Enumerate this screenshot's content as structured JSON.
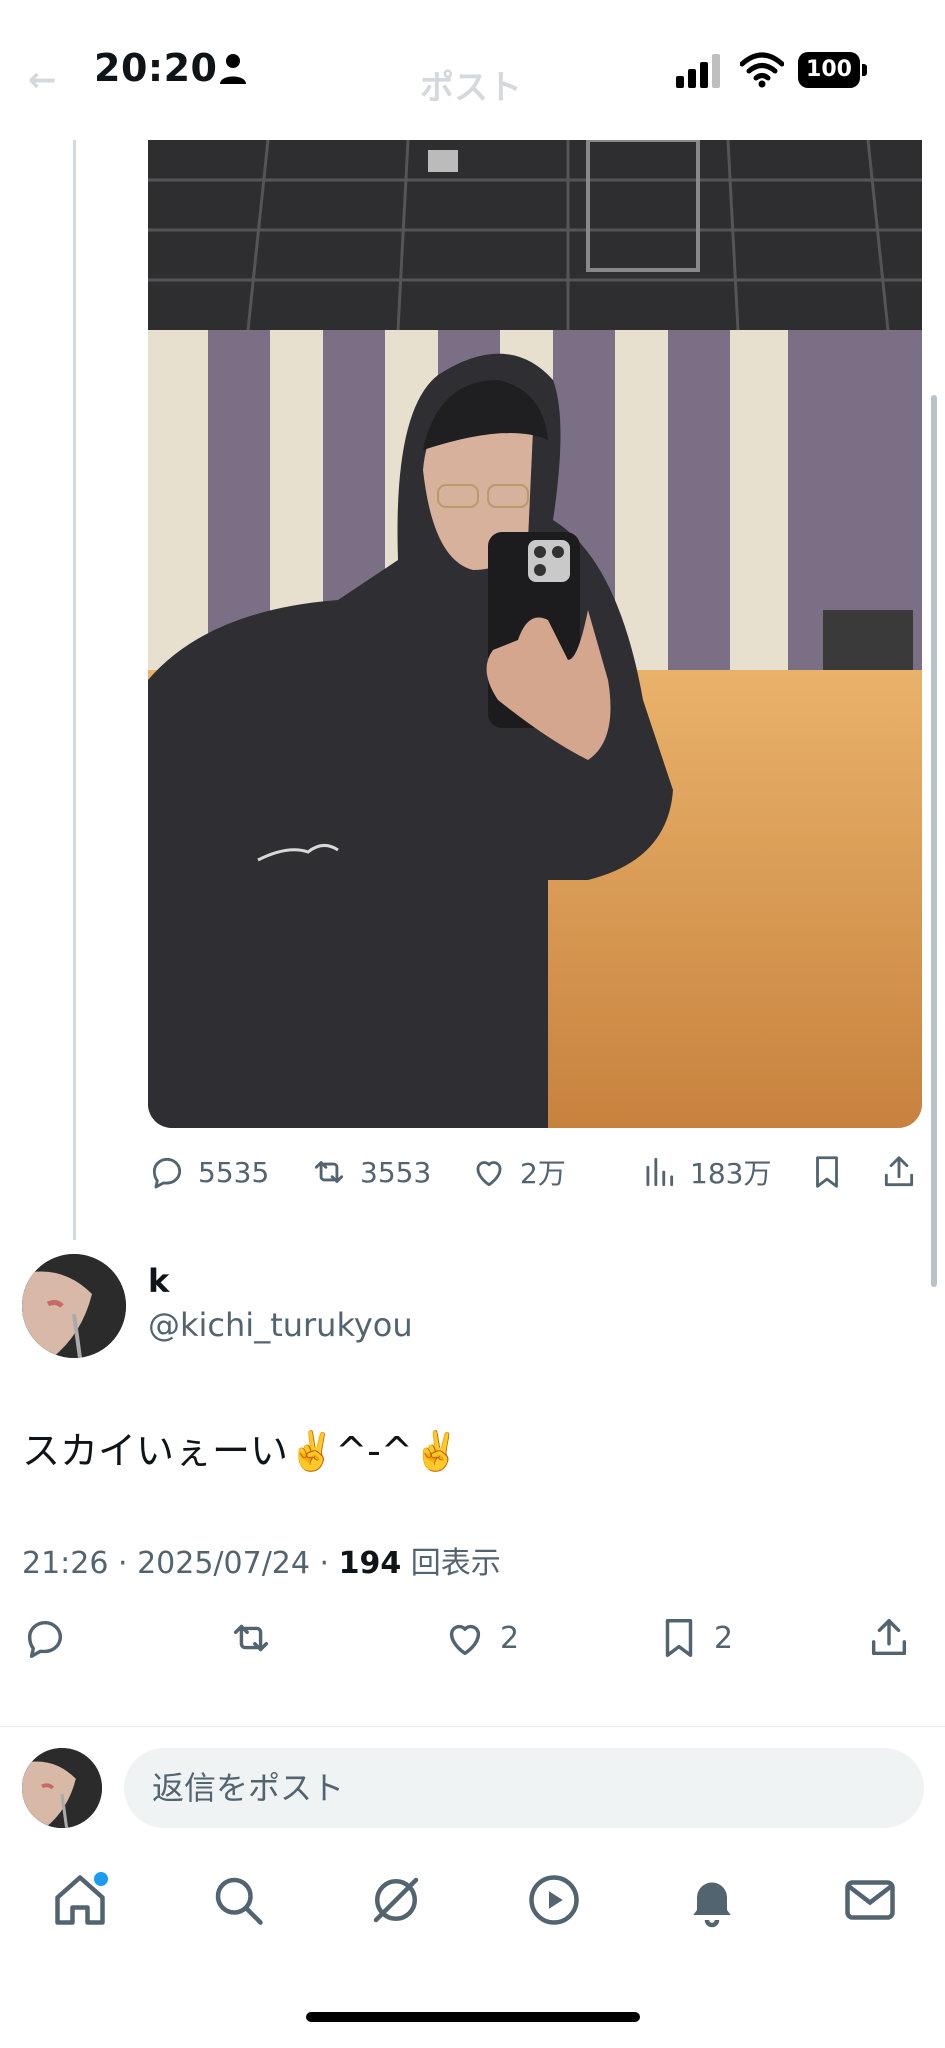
{
  "status_bar": {
    "time": "20:20",
    "battery": "100"
  },
  "header": {
    "title_ghost": "ポスト"
  },
  "previous_post": {
    "stats": {
      "replies": "5535",
      "reposts": "3553",
      "likes": "2万",
      "views": "183万"
    }
  },
  "reply_post": {
    "user_name": "k",
    "handle": "@kichi_turukyou",
    "text": "スカイいぇーい✌️^-^✌️",
    "timestamp": "21:26 · 2025/07/24 · ",
    "view_count": "194",
    "view_suffix": " 回表示",
    "likes": "2",
    "bookmarks": "2"
  },
  "composer": {
    "placeholder": "返信をポスト"
  },
  "icons": [
    "back-arrow-icon",
    "person-icon",
    "signal-icon",
    "wifi-icon",
    "battery-icon",
    "reply-icon",
    "repost-icon",
    "like-icon",
    "views-icon",
    "bookmark-icon",
    "share-icon",
    "home-icon",
    "search-icon",
    "grok-icon",
    "video-icon",
    "notifications-icon",
    "messages-icon"
  ],
  "colors": {
    "accent": "#1d9bf0",
    "muted": "#536471",
    "text": "#0f1419"
  }
}
